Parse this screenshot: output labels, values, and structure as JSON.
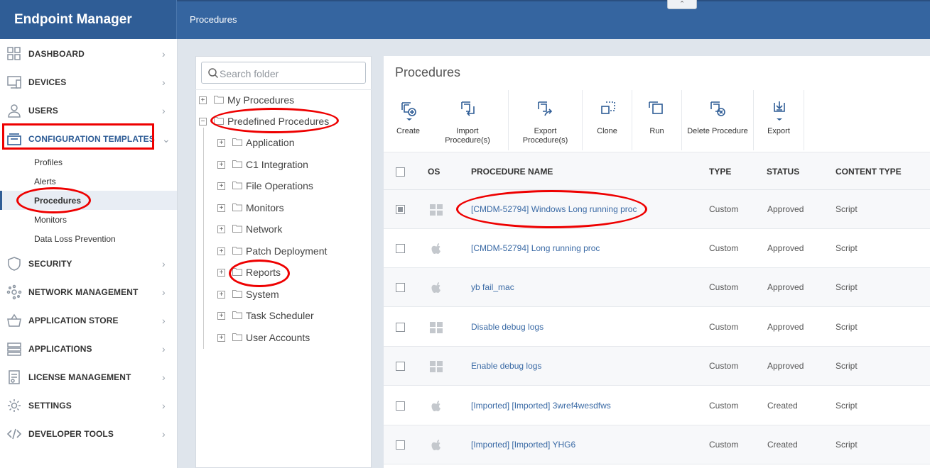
{
  "app": {
    "title": "Endpoint Manager",
    "breadcrumb": "Procedures",
    "collapse_glyph": "⌃"
  },
  "sidebar": {
    "items": [
      {
        "label": "DASHBOARD",
        "icon": "dashboard-grid-icon"
      },
      {
        "label": "DEVICES",
        "icon": "devices-icon"
      },
      {
        "label": "USERS",
        "icon": "user-icon"
      },
      {
        "label": "CONFIGURATION TEMPLATES",
        "icon": "templates-icon"
      },
      {
        "label": "SECURITY",
        "icon": "shield-icon"
      },
      {
        "label": "NETWORK MANAGEMENT",
        "icon": "network-icon"
      },
      {
        "label": "APPLICATION STORE",
        "icon": "basket-icon"
      },
      {
        "label": "APPLICATIONS",
        "icon": "applications-icon"
      },
      {
        "label": "LICENSE MANAGEMENT",
        "icon": "license-icon"
      },
      {
        "label": "SETTINGS",
        "icon": "gear-icon"
      },
      {
        "label": "DEVELOPER TOOLS",
        "icon": "code-icon"
      }
    ],
    "sub_items": [
      "Profiles",
      "Alerts",
      "Procedures",
      "Monitors",
      "Data Loss Prevention"
    ],
    "chevron_right": "›",
    "chevron_down": "⌄"
  },
  "folders": {
    "search_placeholder": "Search folder",
    "roots": [
      "My Procedures",
      "Predefined Procedures"
    ],
    "children": [
      "Application",
      "C1 Integration",
      "File Operations",
      "Monitors",
      "Network",
      "Patch Deployment",
      "Reports",
      "System",
      "Task Scheduler",
      "User Accounts"
    ],
    "expand_glyph": "+",
    "collapse_glyph": "−"
  },
  "main": {
    "title": "Procedures",
    "toolbar": {
      "create": "Create",
      "import_1": "Import",
      "import_2": "Procedure(s)",
      "export_proc_1": "Export",
      "export_proc_2": "Procedure(s)",
      "clone": "Clone",
      "run": "Run",
      "delete": "Delete Procedure",
      "export": "Export"
    },
    "columns": {
      "os": "OS",
      "name": "PROCEDURE NAME",
      "type": "TYPE",
      "status": "STATUS",
      "content": "CONTENT TYPE"
    },
    "rows": [
      {
        "os": "windows",
        "name": "[CMDM-52794] Windows Long running proc",
        "type": "Custom",
        "status": "Approved",
        "content": "Script",
        "checked": true
      },
      {
        "os": "apple",
        "name": "[CMDM-52794] Long running proc",
        "type": "Custom",
        "status": "Approved",
        "content": "Script",
        "checked": false
      },
      {
        "os": "apple",
        "name": "yb fail_mac",
        "type": "Custom",
        "status": "Approved",
        "content": "Script",
        "checked": false
      },
      {
        "os": "windows",
        "name": "Disable debug logs",
        "type": "Custom",
        "status": "Approved",
        "content": "Script",
        "checked": false
      },
      {
        "os": "windows",
        "name": "Enable debug logs",
        "type": "Custom",
        "status": "Approved",
        "content": "Script",
        "checked": false
      },
      {
        "os": "apple",
        "name": "[Imported] [Imported] 3wref4wesdfws",
        "type": "Custom",
        "status": "Created",
        "content": "Script",
        "checked": false
      },
      {
        "os": "apple",
        "name": "[Imported] [Imported] YHG6",
        "type": "Custom",
        "status": "Created",
        "content": "Script",
        "checked": false
      }
    ]
  },
  "colors": {
    "header": "#3565a0",
    "brand": "#2f5d96",
    "link": "#3a6aa5",
    "annotation": "#ee0000"
  }
}
